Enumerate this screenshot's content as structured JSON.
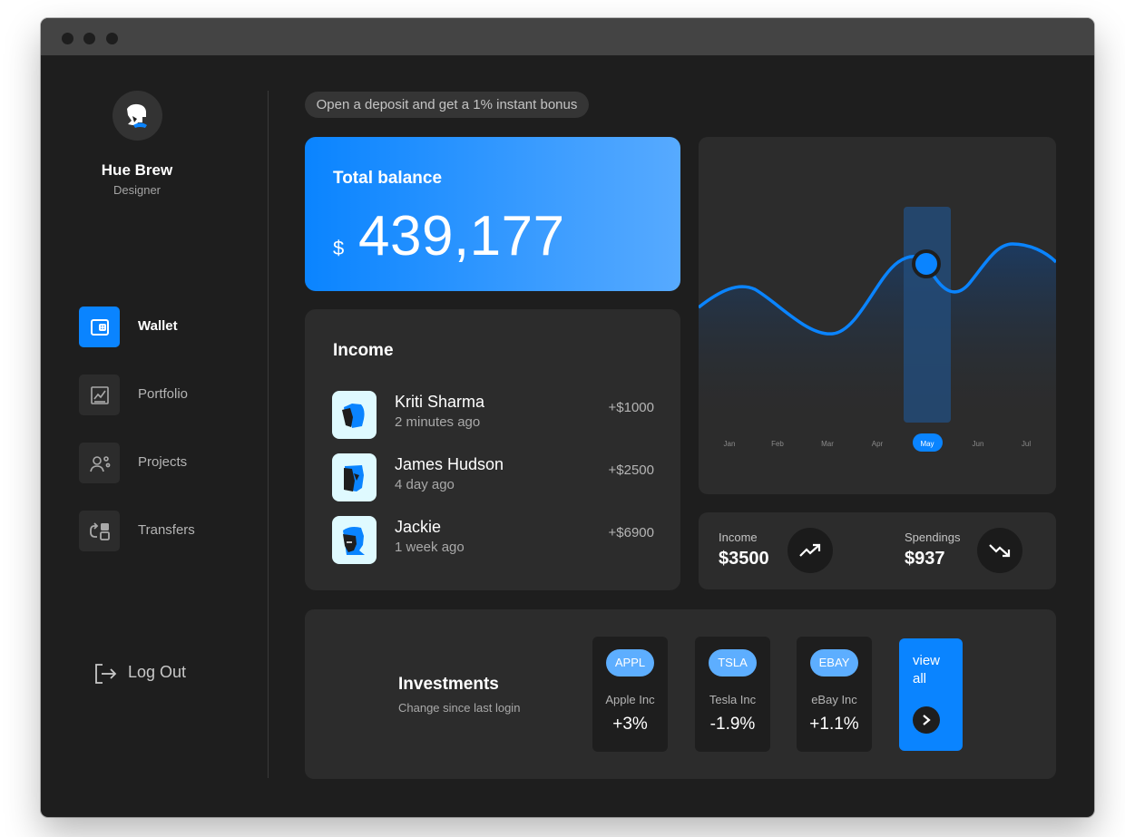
{
  "user": {
    "name": "Hue Brew",
    "role": "Designer"
  },
  "nav": {
    "items": [
      {
        "label": "Wallet",
        "icon": "wallet-icon",
        "active": true
      },
      {
        "label": "Portfolio",
        "icon": "chart-icon",
        "active": false
      },
      {
        "label": "Projects",
        "icon": "user-gear-icon",
        "active": false
      },
      {
        "label": "Transfers",
        "icon": "transfer-icon",
        "active": false
      }
    ],
    "logout_label": "Log Out"
  },
  "promo": "Open a deposit and get a 1% instant bonus",
  "balance": {
    "title": "Total balance",
    "currency": "$",
    "amount": "439,177"
  },
  "income": {
    "title": "Income",
    "transactions": [
      {
        "name": "Kriti Sharma",
        "time": "2 minutes ago",
        "amount": "+$1000"
      },
      {
        "name": "James Hudson",
        "time": "4 day ago",
        "amount": "+$2500"
      },
      {
        "name": "Jackie",
        "time": "1 week ago",
        "amount": "+$6900"
      }
    ]
  },
  "chart_data": {
    "type": "area",
    "categories": [
      "Jan",
      "Feb",
      "Mar",
      "Apr",
      "May",
      "Jun",
      "Jul"
    ],
    "highlight": "May",
    "series_color": "#0a84ff",
    "grid": false,
    "legend": "none"
  },
  "stats": {
    "income_label": "Income",
    "income_value": "$3500",
    "spendings_label": "Spendings",
    "spendings_value": "$937"
  },
  "investments": {
    "title": "Investments",
    "subtitle": "Change since last login",
    "stocks": [
      {
        "ticker": "APPL",
        "name": "Apple Inc",
        "change": "+3%"
      },
      {
        "ticker": "TSLA",
        "name": "Tesla Inc",
        "change": "-1.9%"
      },
      {
        "ticker": "EBAY",
        "name": "eBay Inc",
        "change": "+1.1%"
      }
    ],
    "view_all_label": "view all"
  },
  "colors": {
    "accent": "#0a84ff",
    "accent_light": "#5daeff",
    "background": "#1e1e1e",
    "card": "#2c2c2c"
  }
}
